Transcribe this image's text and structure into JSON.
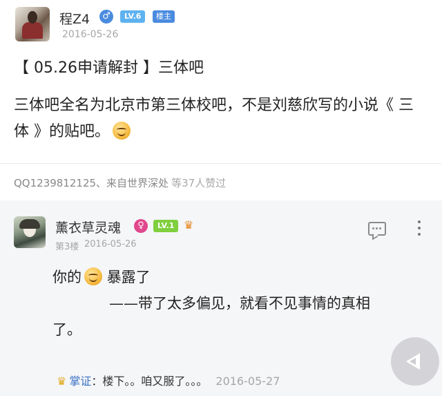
{
  "post": {
    "author": "程Z4",
    "gender_symbol": "♂",
    "level": "LV.6",
    "owner_badge": "楼主",
    "date": "2016-05-26",
    "title": "【 05.26申请解封 】三体吧",
    "body": "三体吧全名为北京市第三体校吧，不是刘慈欣写的小说《 三体 》的贴吧。",
    "source": "QQ1239812125、来自世界深处",
    "likes": "等37人赞过"
  },
  "reply": {
    "author": "薰衣草灵魂",
    "gender_symbol": "♀",
    "level": "LV.1",
    "floor": "第3楼",
    "date": "2016-05-26",
    "line1": "你的",
    "line1_suffix": "暴露了",
    "line2": "——带了太多偏见，就看不见事情的真相",
    "line3": "了。",
    "sub_author": "掌证",
    "sub_text": "楼下。。咱又服了。。。",
    "sub_date": "2016-05-27"
  },
  "colors": {
    "accent_blue": "#4a8bdf",
    "level_badge": "#5fb2f0",
    "level_badge_new": "#7fcf3e",
    "female_pink": "#e0478c",
    "subreply_name": "#3c72c4"
  },
  "icons": {
    "comment": "comment-icon",
    "more": "more-vertical-icon",
    "back": "back-triangle-icon",
    "smiley": "smiley-emoji-icon",
    "crown": "crown-icon"
  }
}
